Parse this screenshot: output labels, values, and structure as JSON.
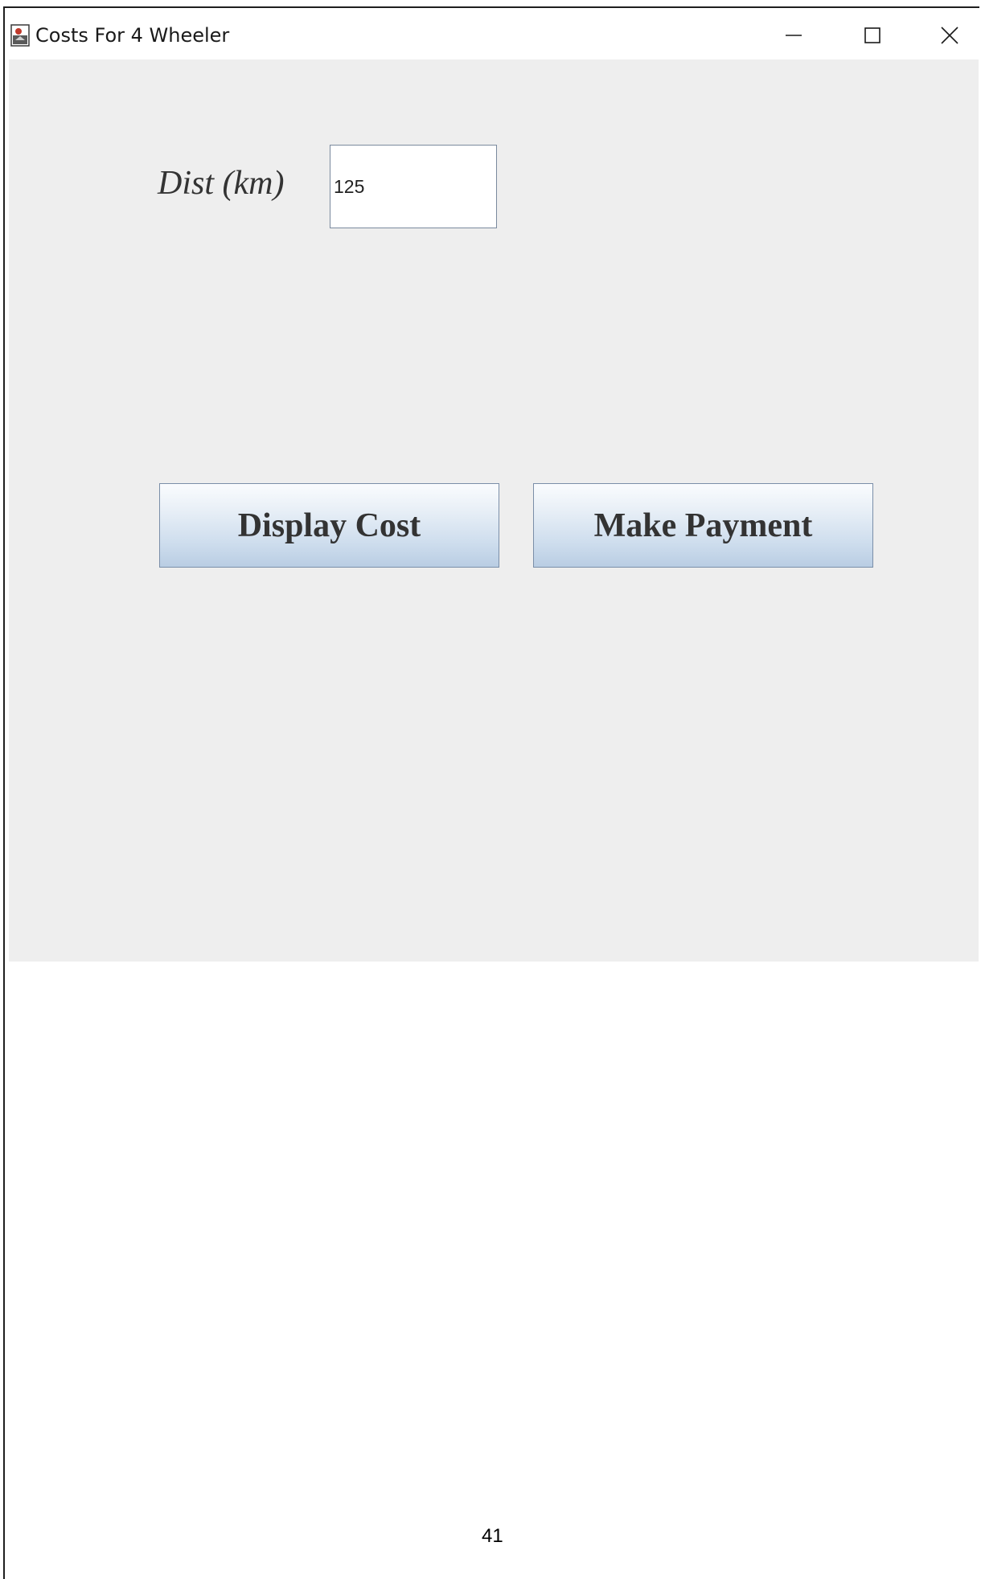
{
  "window": {
    "title": "Costs For 4 Wheeler",
    "icon": "java-app-icon",
    "controls": {
      "minimize_icon": "minimize-icon",
      "maximize_icon": "maximize-icon",
      "close_icon": "close-icon"
    }
  },
  "form": {
    "distance_label": "Dist (km)",
    "distance_value": "125"
  },
  "actions": {
    "display_cost_label": "Display Cost",
    "make_payment_label": "Make Payment"
  },
  "colors": {
    "panel_background": "#eeeeee",
    "button_gradient_top": "#fafcfe",
    "button_gradient_bottom": "#b9cde3",
    "button_border": "#7a8ea8",
    "text": "#333333"
  },
  "page": {
    "number": "41"
  }
}
